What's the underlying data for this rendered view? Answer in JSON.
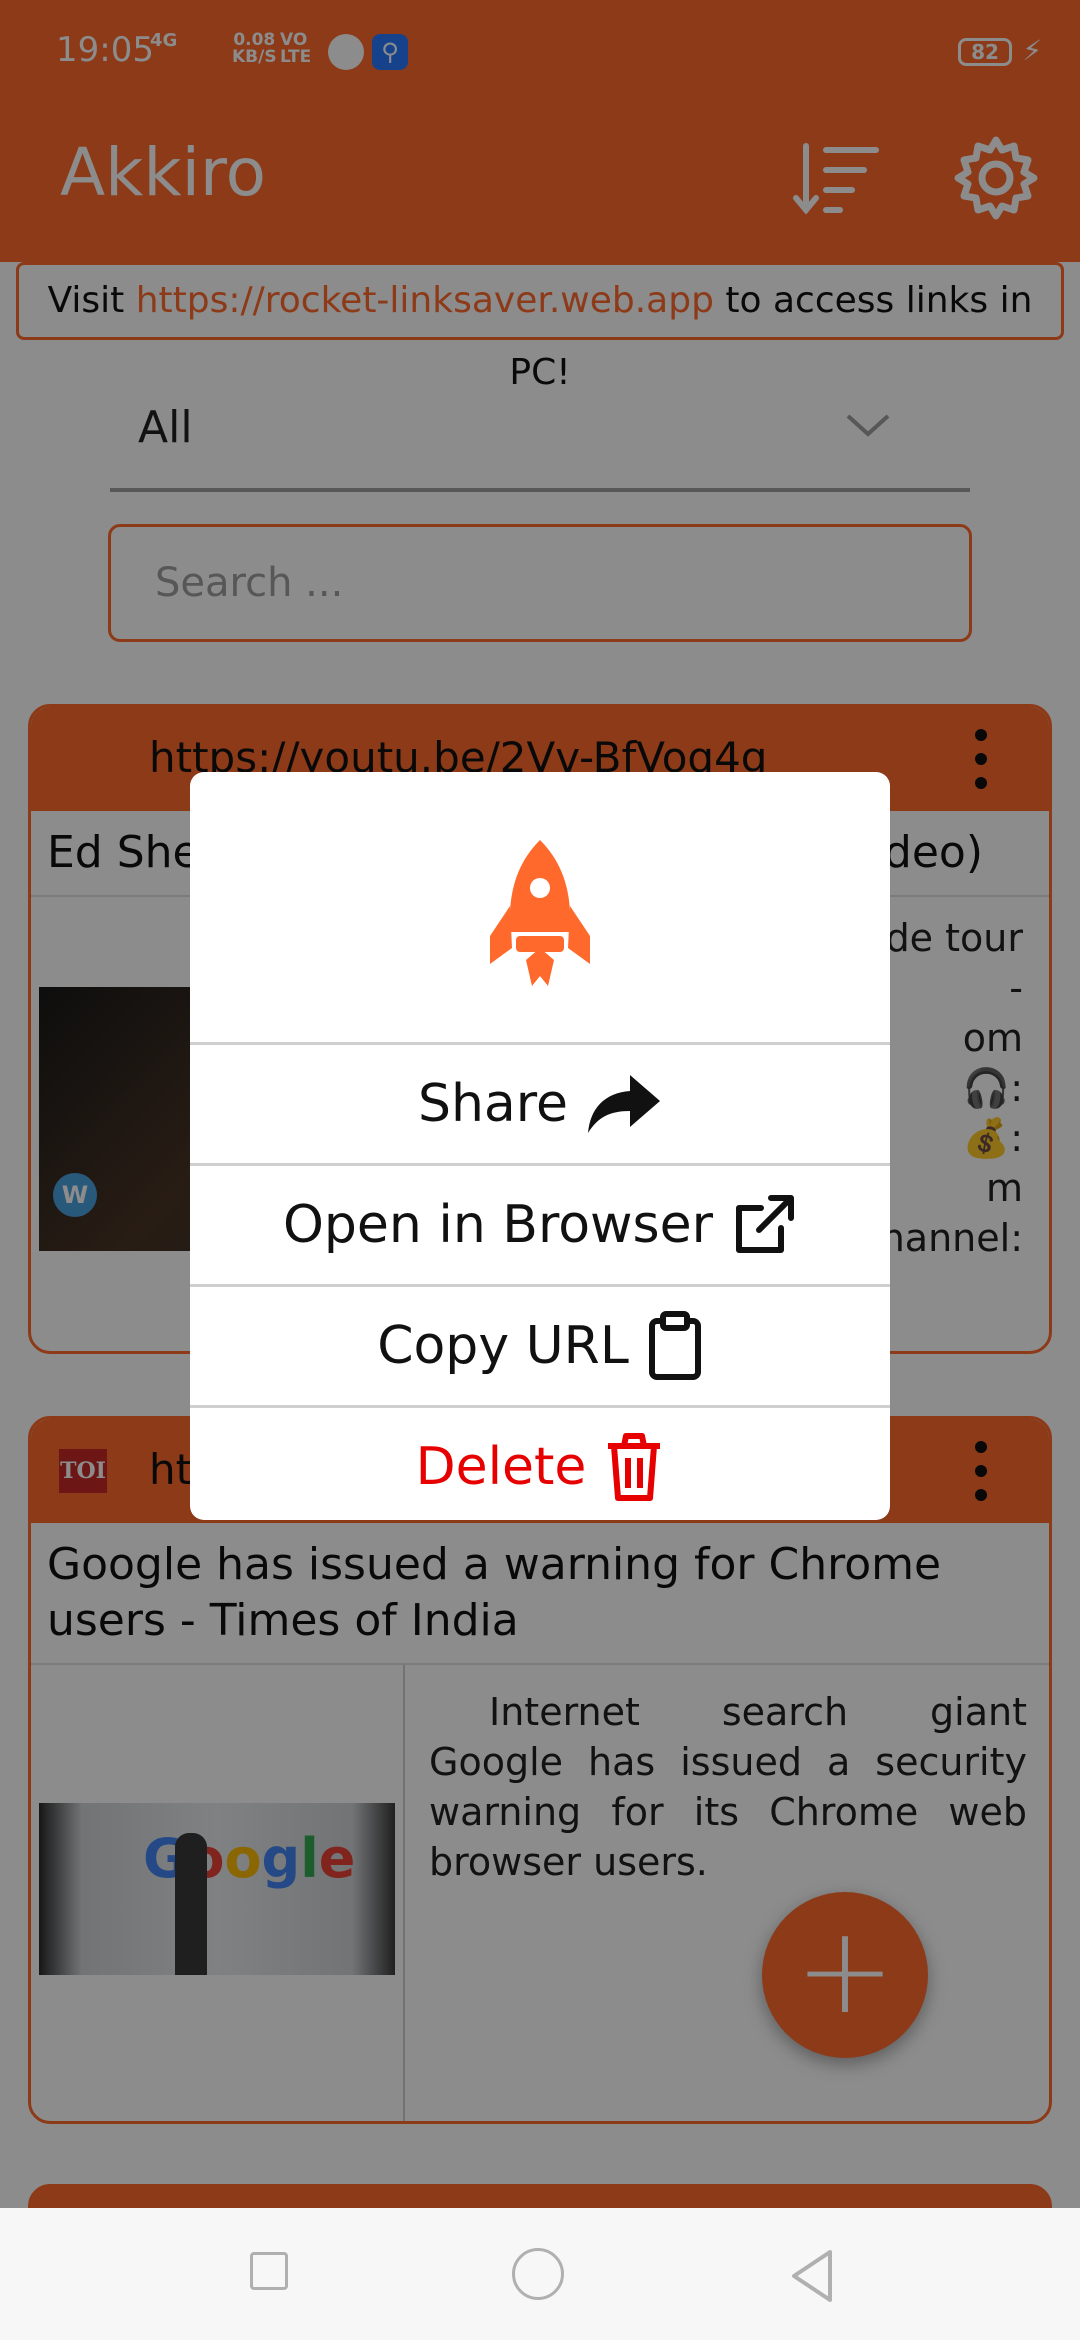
{
  "status_bar": {
    "time": "19:05",
    "network": "4G",
    "speed_value": "0.08",
    "speed_unit": "KB/S",
    "volte_top": "VO",
    "volte_bottom": "LTE",
    "battery": "82"
  },
  "app_bar": {
    "title": "Akkiro",
    "sort_icon": "sort-icon",
    "settings_icon": "gear-icon"
  },
  "banner": {
    "prefix": "Visit ",
    "link": "https://rocket-linksaver.web.app",
    "suffix": " to access links in PC!"
  },
  "filter": {
    "selected": "All"
  },
  "search": {
    "placeholder": "Search ..."
  },
  "cards": [
    {
      "url": "https://youtu.be/2Vv-BfVoq4g",
      "title_left": "Ed She",
      "title_right": "deo)",
      "desc_lines": [
        "de  tour",
        "-",
        "om",
        ":",
        ":",
        "m",
        "hannel:"
      ]
    },
    {
      "url": "ht",
      "title": "Google has issued a warning for Chrome users - Times of India",
      "desc": "Internet search giant Google has issued a security warning for its Chrome web browser users.",
      "source_badge": "TOI",
      "thumb_text": "Google"
    }
  ],
  "dialog": {
    "icon": "rocket-icon",
    "options": {
      "share": "Share",
      "open_browser": "Open in Browser",
      "copy_url": "Copy URL",
      "delete": "Delete"
    }
  },
  "colors": {
    "accent": "#ff6a2c",
    "delete": "#e60000"
  }
}
